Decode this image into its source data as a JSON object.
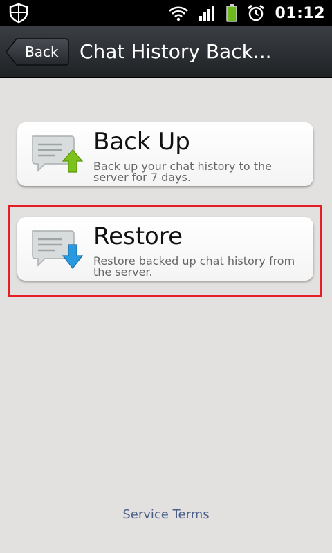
{
  "status_bar": {
    "time": "01:12",
    "icons": [
      "shield-icon",
      "wifi-icon",
      "signal-icon",
      "battery-icon",
      "alarm-icon"
    ]
  },
  "header": {
    "back_label": "Back",
    "title": "Chat History Back..."
  },
  "options": [
    {
      "title": "Back Up",
      "description": "Back up your chat history to the server for 7 days.",
      "icon": "chat-upload-icon"
    },
    {
      "title": "Restore",
      "description": "Restore backed up chat history from the server.",
      "icon": "chat-download-icon"
    }
  ],
  "footer": {
    "link": "Service Terms"
  },
  "colors": {
    "highlight": "#e41e24",
    "link": "#4a5f87",
    "upload_arrow": "#7cc21b",
    "download_arrow": "#2a9ae0"
  }
}
